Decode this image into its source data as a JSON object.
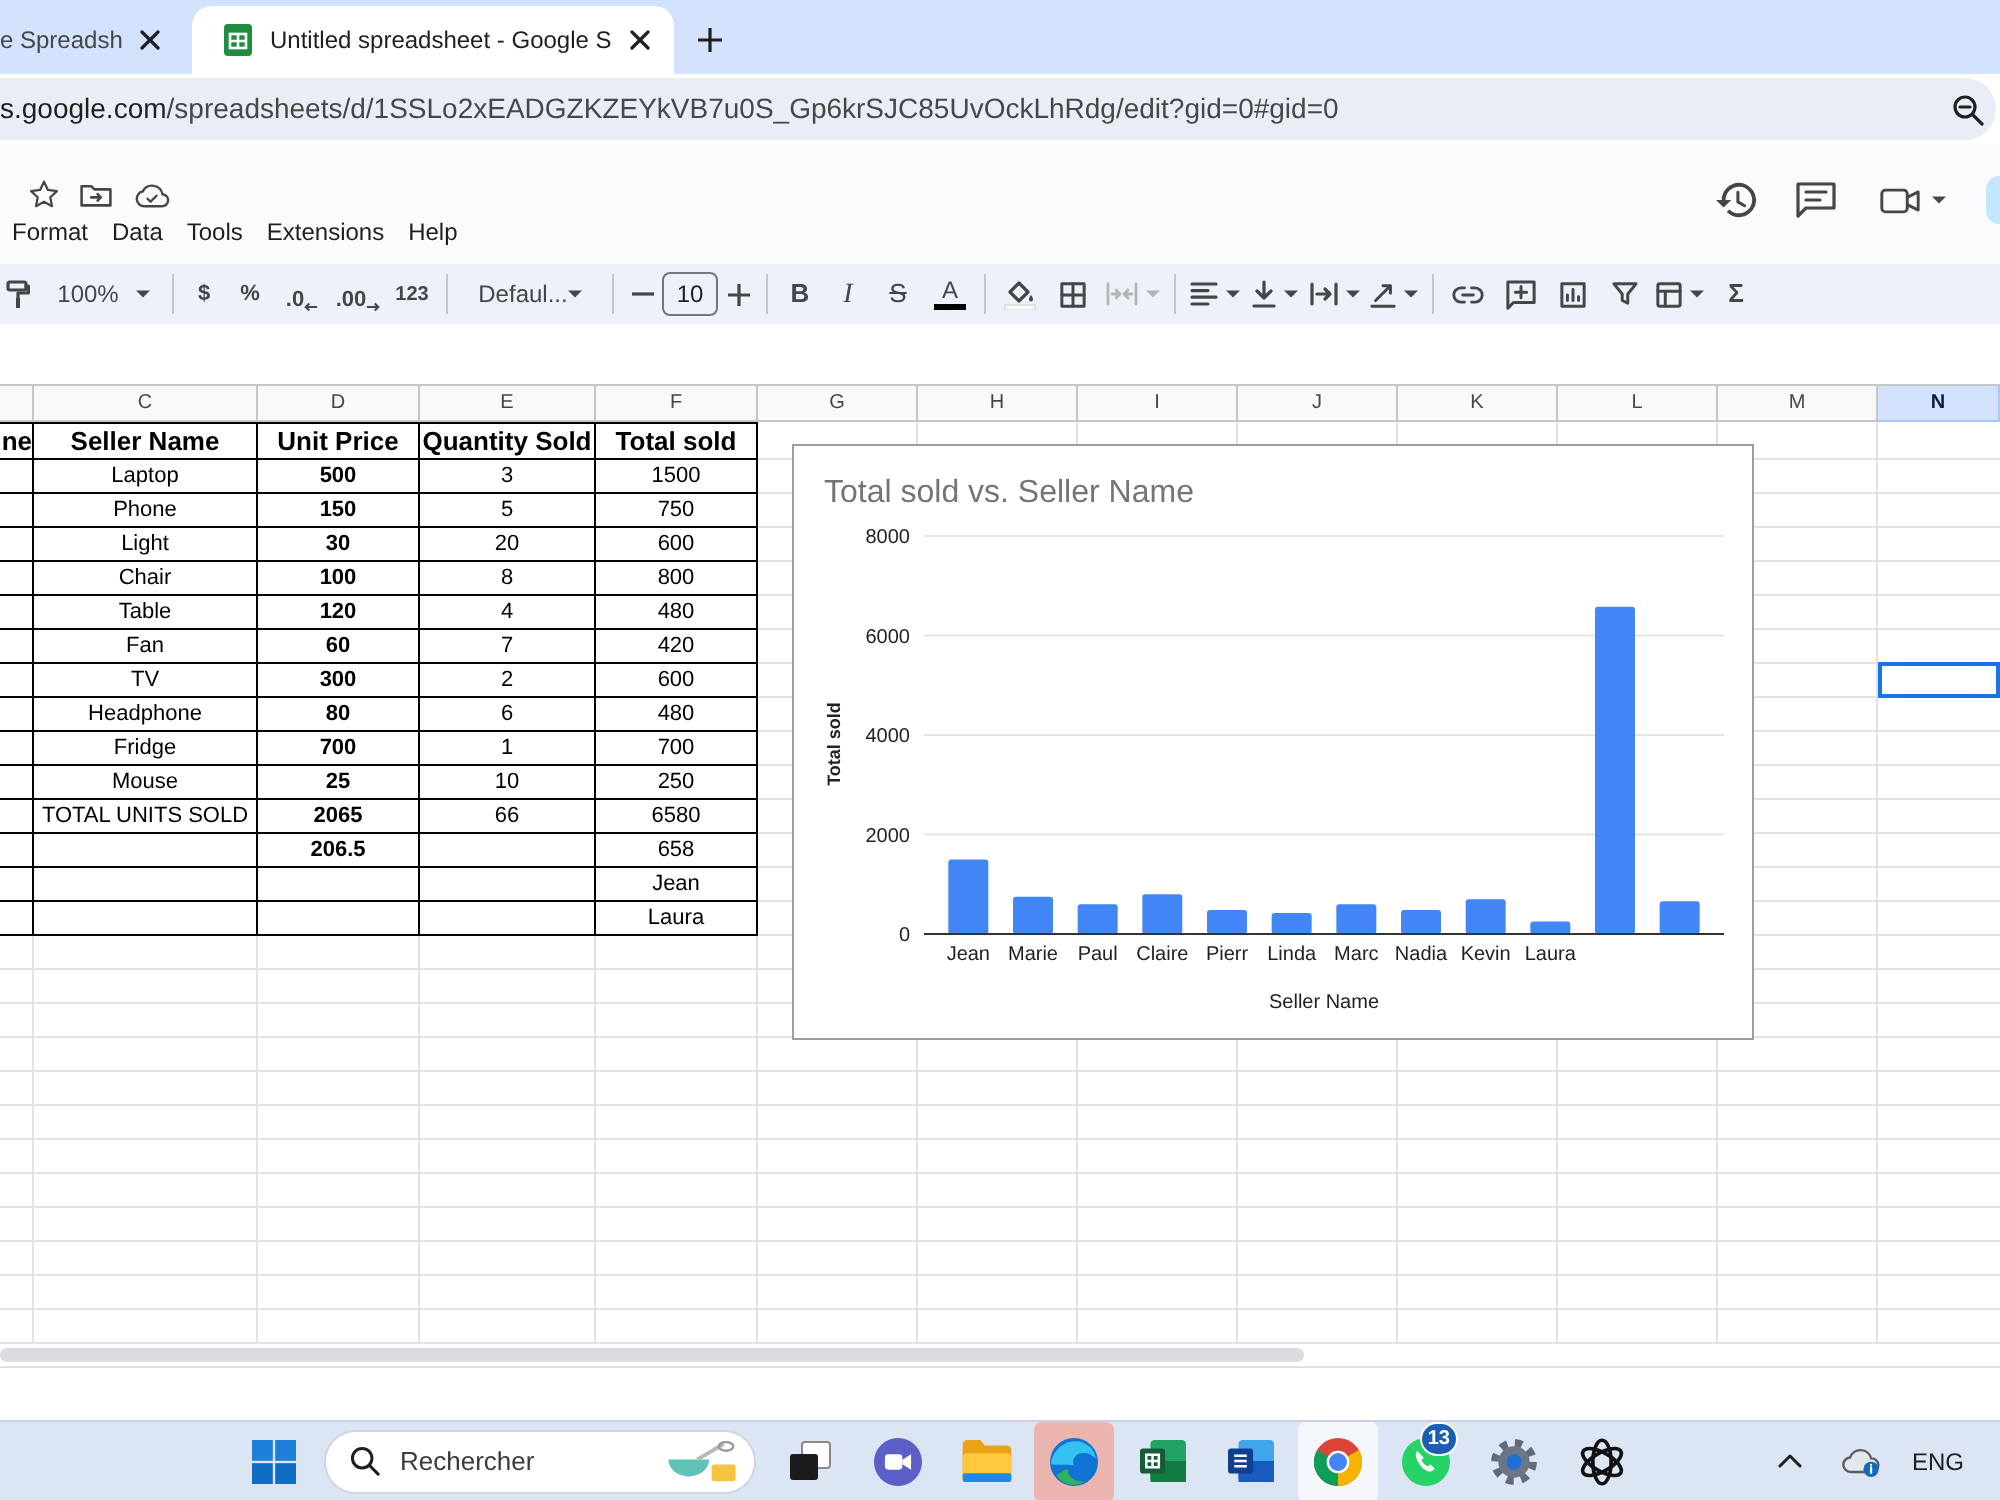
{
  "browser": {
    "tabs": [
      {
        "title": "e Spreadsh",
        "selected": false
      },
      {
        "title": "Untitled spreadsheet - Google S",
        "selected": true
      }
    ],
    "address": {
      "host": "s.google.com",
      "path": "/spreadsheets/d/1SSLo2xEADGZKZEYkVB7u0S_Gp6krSJC85UvOckLhRdg/edit?gid=0#gid=0"
    }
  },
  "menu": [
    "Format",
    "Data",
    "Tools",
    "Extensions",
    "Help"
  ],
  "toolbar": {
    "zoom": "100%",
    "currency": "$",
    "percent": "%",
    "decrease_decimals": ".0",
    "increase_decimals": ".00",
    "number_format": "123",
    "font": "Defaul...",
    "font_size": "10",
    "bold": "B",
    "italic": "I",
    "strikethrough": "S",
    "text_color": "A",
    "merge_cells": {
      "disabled": true
    },
    "functions": "Σ"
  },
  "sheet": {
    "columns": [
      {
        "label": "C",
        "selected": false
      },
      {
        "label": "D",
        "selected": false
      },
      {
        "label": "E",
        "selected": false
      },
      {
        "label": "F",
        "selected": false
      },
      {
        "label": "G",
        "selected": false
      },
      {
        "label": "H",
        "selected": false
      },
      {
        "label": "I",
        "selected": false
      },
      {
        "label": "J",
        "selected": false
      },
      {
        "label": "K",
        "selected": false
      },
      {
        "label": "L",
        "selected": false
      },
      {
        "label": "M",
        "selected": false
      },
      {
        "label": "N",
        "selected": true
      }
    ],
    "table": {
      "header_cut": "ne",
      "header": [
        "Seller Name",
        "Unit Price",
        "Quantity Sold",
        "Total sold"
      ],
      "rows": [
        {
          "cells": [
            "Laptop",
            "500",
            "3",
            "1500"
          ],
          "selected": false
        },
        {
          "cells": [
            "Phone",
            "150",
            "5",
            "750"
          ],
          "selected": false
        },
        {
          "cells": [
            "Light",
            "30",
            "20",
            "600"
          ],
          "selected": false
        },
        {
          "cells": [
            "Chair",
            "100",
            "8",
            "800"
          ],
          "selected": false
        },
        {
          "cells": [
            "Table",
            "120",
            "4",
            "480"
          ],
          "selected": false
        },
        {
          "cells": [
            "Fan",
            "60",
            "7",
            "420"
          ],
          "selected": false
        },
        {
          "cells": [
            "TV",
            "300",
            "2",
            "600"
          ],
          "selected": true
        },
        {
          "cells": [
            "Headphone",
            "80",
            "6",
            "480"
          ],
          "selected": false
        },
        {
          "cells": [
            "Fridge",
            "700",
            "1",
            "700"
          ],
          "selected": false
        },
        {
          "cells": [
            "Mouse",
            "25",
            "10",
            "250"
          ],
          "selected": false
        },
        {
          "cells": [
            "TOTAL UNITS SOLD",
            "2065",
            "66",
            "6580"
          ],
          "selected": false
        },
        {
          "cells": [
            null,
            "206.5",
            null,
            "658"
          ],
          "selected": false
        },
        {
          "cells": [
            null,
            null,
            null,
            "Jean"
          ],
          "selected": false
        },
        {
          "cells": [
            null,
            null,
            null,
            "Laura"
          ],
          "selected": false
        }
      ]
    },
    "chart_data": {
      "type": "bar",
      "title": "Total sold vs. Seller Name",
      "xlabel": "Seller Name",
      "ylabel": "Total sold",
      "categories": [
        "Jean",
        "Marie",
        "Paul",
        "Claire",
        "Pierr",
        "Linda",
        "Marc",
        "Nadia",
        "Kevin",
        "Laura",
        null,
        null
      ],
      "values": [
        1500,
        750,
        600,
        800,
        480,
        420,
        600,
        480,
        700,
        250,
        6580,
        658
      ],
      "ylim": [
        0,
        8000
      ],
      "yticks": [
        0,
        2000,
        4000,
        6000,
        8000
      ],
      "grid": true
    }
  },
  "taskbar": {
    "search": {
      "placeholder": "Rechercher"
    },
    "apps": [
      {
        "selected": false,
        "attention": false
      },
      {
        "selected": false,
        "attention": false
      },
      {
        "selected": false,
        "attention": false
      },
      {
        "selected": false,
        "attention": true
      },
      {
        "selected": false,
        "attention": false
      },
      {
        "selected": false,
        "attention": false
      },
      {
        "selected": true,
        "attention": false
      },
      {
        "selected": false,
        "attention": false,
        "badge": "13"
      },
      {
        "selected": false,
        "attention": false
      },
      {
        "selected": false,
        "attention": false
      }
    ],
    "language": "ENG"
  }
}
